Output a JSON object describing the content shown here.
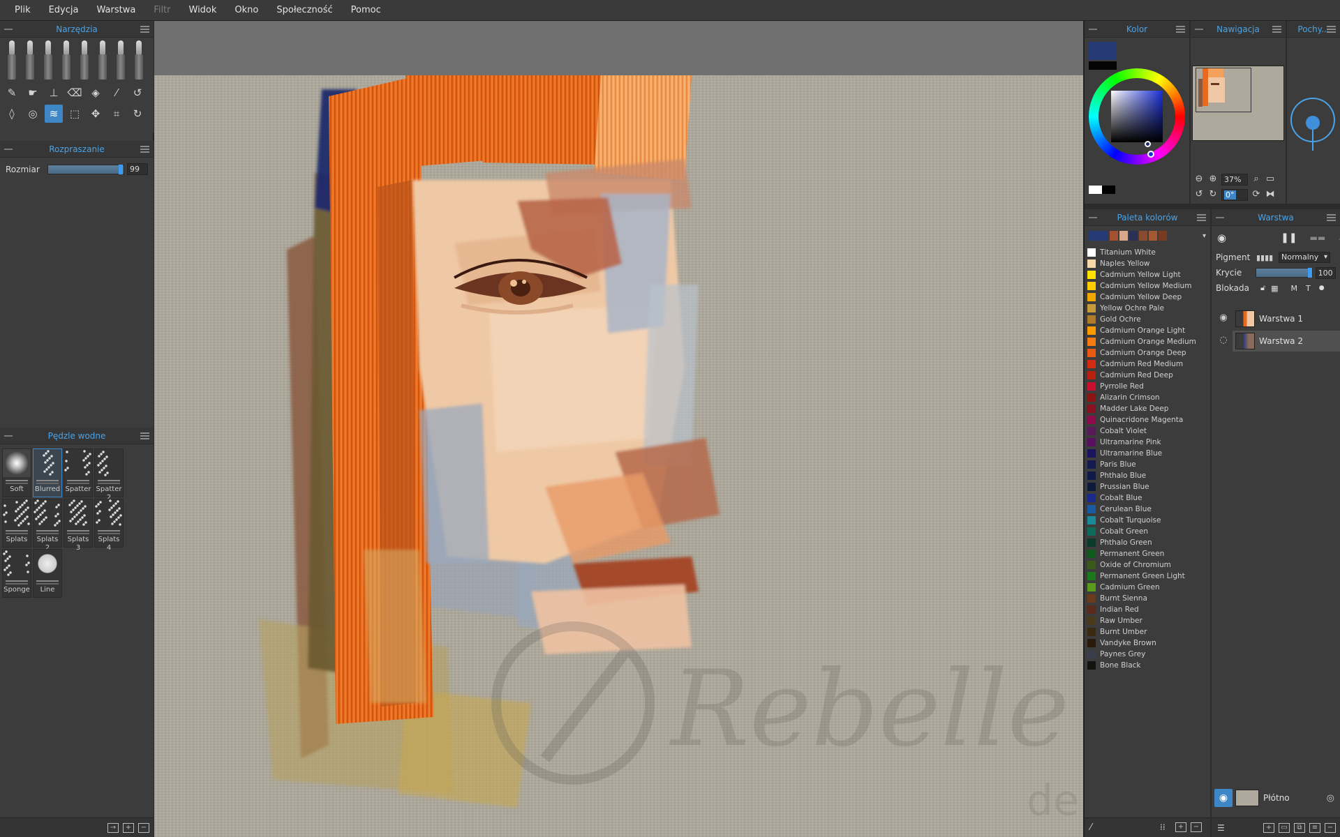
{
  "menu": {
    "items": [
      {
        "label": "Plik",
        "disabled": false
      },
      {
        "label": "Edycja",
        "disabled": false
      },
      {
        "label": "Warstwa",
        "disabled": false
      },
      {
        "label": "Filtr",
        "disabled": true
      },
      {
        "label": "Widok",
        "disabled": false
      },
      {
        "label": "Okno",
        "disabled": false
      },
      {
        "label": "Społeczność",
        "disabled": false
      },
      {
        "label": "Pomoc",
        "disabled": false
      }
    ]
  },
  "tools": {
    "title": "Narzędzia",
    "row1_icons": [
      "pencil-icon",
      "smudge-icon",
      "stamp-icon",
      "eraser-icon",
      "fill-icon",
      "eyedropper-icon",
      "undo-icon"
    ],
    "row2_icons": [
      "water-drop-icon",
      "tape-icon",
      "blow-icon",
      "selection-icon",
      "transform-icon",
      "crop-icon",
      "redo-icon"
    ],
    "active_icon": "blow-icon"
  },
  "spread": {
    "title": "Rozpraszanie",
    "size_label": "Rozmiar",
    "size_value": "99",
    "size_level": 0.99
  },
  "water_brushes": {
    "title": "Pędzle wodne",
    "items": [
      {
        "name": "Soft",
        "selected": false
      },
      {
        "name": "Blurred",
        "selected": true
      },
      {
        "name": "Spatter",
        "selected": false
      },
      {
        "name": "Spatter 2",
        "selected": false
      },
      {
        "name": "Splats",
        "selected": false
      },
      {
        "name": "Splats 2",
        "selected": false
      },
      {
        "name": "Splats 3",
        "selected": false
      },
      {
        "name": "Splats 4",
        "selected": false
      },
      {
        "name": "Sponge",
        "selected": false
      },
      {
        "name": "Line",
        "selected": false
      }
    ]
  },
  "color": {
    "title": "Kolor",
    "current": "#263a76",
    "secondary": "#050505"
  },
  "navigation": {
    "title": "Nawigacja",
    "zoom": "37%",
    "rotation": "0°"
  },
  "tilt": {
    "title": "Pochy..."
  },
  "palette": {
    "title": "Paleta kolorów",
    "recent": [
      "#263a76",
      "#a55030",
      "#d9a78a",
      "#2a2f55",
      "#8a4a30",
      "#a35a30",
      "#7a3a20"
    ],
    "colors": [
      {
        "name": "Titanium White",
        "hex": "#ffffff"
      },
      {
        "name": "Naples Yellow",
        "hex": "#f5d9a8"
      },
      {
        "name": "Cadmium Yellow Light",
        "hex": "#ffe100"
      },
      {
        "name": "Cadmium Yellow Medium",
        "hex": "#ffcc00"
      },
      {
        "name": "Cadmium Yellow Deep",
        "hex": "#f0a800"
      },
      {
        "name": "Yellow Ochre Pale",
        "hex": "#c89a3a"
      },
      {
        "name": "Gold Ochre",
        "hex": "#b07a2a"
      },
      {
        "name": "Cadmium Orange Light",
        "hex": "#ff9a00"
      },
      {
        "name": "Cadmium Orange Medium",
        "hex": "#f57a10"
      },
      {
        "name": "Cadmium Orange Deep",
        "hex": "#ea5a10"
      },
      {
        "name": "Cadmium Red Medium",
        "hex": "#d42a10"
      },
      {
        "name": "Cadmium Red Deep",
        "hex": "#b8200e"
      },
      {
        "name": "Pyrrolle Red",
        "hex": "#c8102e"
      },
      {
        "name": "Alizarin Crimson",
        "hex": "#8e1414"
      },
      {
        "name": "Madder Lake Deep",
        "hex": "#8a1020"
      },
      {
        "name": "Quinacridone Magenta",
        "hex": "#8e0a4a"
      },
      {
        "name": "Cobalt Violet",
        "hex": "#5a1a5a"
      },
      {
        "name": "Ultramarine Pink",
        "hex": "#5a1060"
      },
      {
        "name": "Ultramarine Blue",
        "hex": "#1a1460"
      },
      {
        "name": "Paris Blue",
        "hex": "#141a50"
      },
      {
        "name": "Phthalo Blue",
        "hex": "#101a48"
      },
      {
        "name": "Prussian Blue",
        "hex": "#0e1a3a"
      },
      {
        "name": "Cobalt Blue",
        "hex": "#1a2a8a"
      },
      {
        "name": "Cerulean Blue",
        "hex": "#1a5aa0"
      },
      {
        "name": "Cobalt Turquoise",
        "hex": "#1a8a9a"
      },
      {
        "name": "Cobalt Green",
        "hex": "#0e6a5a"
      },
      {
        "name": "Phthalo Green",
        "hex": "#0a3a2a"
      },
      {
        "name": "Permanent Green",
        "hex": "#0e5a1a"
      },
      {
        "name": "Oxide of Chromium",
        "hex": "#3a5a1a"
      },
      {
        "name": "Permanent Green Light",
        "hex": "#1a7a1a"
      },
      {
        "name": "Cadmium Green",
        "hex": "#5a9a1a"
      },
      {
        "name": "Burnt Sienna",
        "hex": "#6a3a1a"
      },
      {
        "name": "Indian Red",
        "hex": "#5a2a1a"
      },
      {
        "name": "Raw Umber",
        "hex": "#4a3a1a"
      },
      {
        "name": "Burnt Umber",
        "hex": "#3a2a10"
      },
      {
        "name": "Vandyke Brown",
        "hex": "#2a1a0a"
      },
      {
        "name": "Paynes Grey",
        "hex": "#3a3e4a"
      },
      {
        "name": "Bone Black",
        "hex": "#14120e"
      }
    ]
  },
  "layers": {
    "title": "Warstwa",
    "pigment_label": "Pigment",
    "blend_mode": "Normalny",
    "opacity_label": "Krycie",
    "opacity_value": "100",
    "opacity_level": 1.0,
    "lock_label": "Blokada",
    "lock_m": "M",
    "lock_t": "T",
    "items": [
      {
        "name": "Warstwa 1",
        "selected": false
      },
      {
        "name": "Warstwa 2",
        "selected": true
      }
    ],
    "canvas_label": "Płótno"
  }
}
